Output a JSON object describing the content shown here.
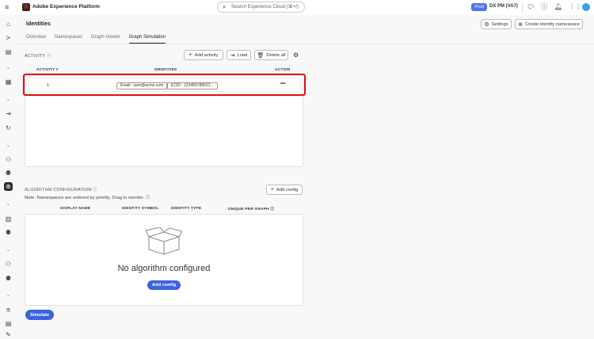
{
  "header": {
    "app_title": "Adobe Experience Platform",
    "search_placeholder": "Search Experience Cloud (⌘+/)",
    "env_badge": "Prod",
    "org": "DX PM (VA7)"
  },
  "page": {
    "title": "Identities",
    "tabs": [
      {
        "label": "Overview"
      },
      {
        "label": "Namespaces"
      },
      {
        "label": "Graph Viewer"
      },
      {
        "label": "Graph Simulation"
      }
    ],
    "settings_label": "Settings",
    "create_label": "Create identity namespace"
  },
  "activity": {
    "section_label": "ACTIVITY",
    "add_label": "Add activity",
    "load_label": "Load",
    "delete_label": "Delete all",
    "columns": [
      "ACTIVITY #",
      "IDENTITIES",
      "ACTION"
    ],
    "rows": [
      {
        "number": "1",
        "identities": [
          "Email : sam@acme.com",
          "ECID : 123456789012..."
        ],
        "action": "•••"
      }
    ]
  },
  "algorithm": {
    "section_label": "ALGORITHM CONFIGURATION",
    "note": "Note: Namespaces are ordered by priority. Drag to reorder.",
    "add_label": "Add config",
    "columns": [
      "DISPLAY NAME",
      "IDENTITY SYMBOL",
      "IDENTITY TYPE",
      "UNIQUE PER GRAPH"
    ],
    "empty_title": "No algorithm configured",
    "empty_button": "Add config"
  },
  "simulate_label": "Simulate"
}
